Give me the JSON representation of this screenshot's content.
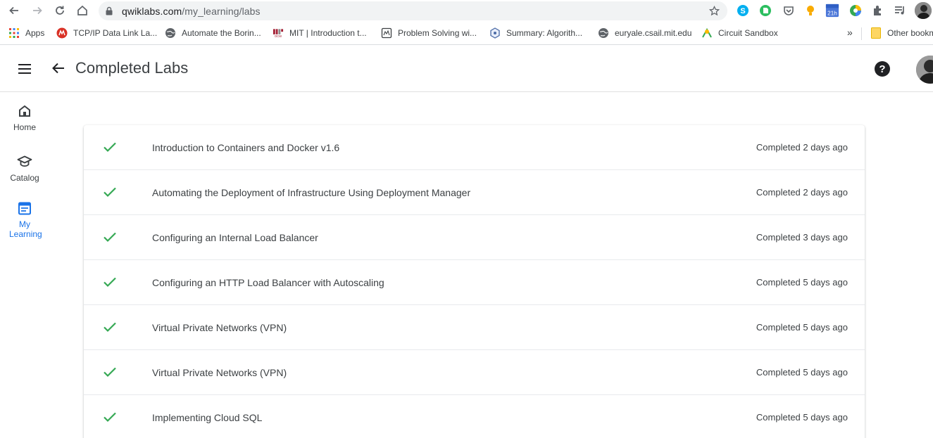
{
  "browser": {
    "url_host": "qwiklabs.com",
    "url_path": "/my_learning/labs",
    "extension_badge": "21h"
  },
  "bookmarks": [
    {
      "label": "Apps",
      "icon": "apps-grid-icon"
    },
    {
      "label": "TCP/IP Data Link La...",
      "icon": "red-logo-icon"
    },
    {
      "label": "Automate the Borin...",
      "icon": "globe-icon"
    },
    {
      "label": "MIT | Introduction t...",
      "icon": "mit-ocw-icon"
    },
    {
      "label": "Problem Solving wi...",
      "icon": "book-icon"
    },
    {
      "label": "Summary: Algorith...",
      "icon": "hexagon-icon"
    },
    {
      "label": "euryale.csail.mit.edu",
      "icon": "globe-icon"
    },
    {
      "label": "Circuit Sandbox",
      "icon": "circuit-icon"
    }
  ],
  "bookmarks_overflow": "»",
  "other_bookmarks": "Other bookmarks",
  "header": {
    "title": "Completed Labs"
  },
  "sidenav": {
    "items": [
      {
        "label": "Home"
      },
      {
        "label": "Catalog"
      },
      {
        "label": "My Learning"
      }
    ]
  },
  "labs": [
    {
      "title": "Introduction to Containers and Docker v1.6",
      "status": "Completed 2 days ago"
    },
    {
      "title": "Automating the Deployment of Infrastructure Using Deployment Manager",
      "status": "Completed 2 days ago"
    },
    {
      "title": "Configuring an Internal Load Balancer",
      "status": "Completed 3 days ago"
    },
    {
      "title": "Configuring an HTTP Load Balancer with Autoscaling",
      "status": "Completed 5 days ago"
    },
    {
      "title": "Virtual Private Networks (VPN)",
      "status": "Completed 5 days ago"
    },
    {
      "title": "Virtual Private Networks (VPN)",
      "status": "Completed 5 days ago"
    },
    {
      "title": "Implementing Cloud SQL",
      "status": "Completed 5 days ago"
    }
  ],
  "colors": {
    "check": "#34a853",
    "active_nav": "#1a73e8",
    "text": "#3c4043"
  }
}
